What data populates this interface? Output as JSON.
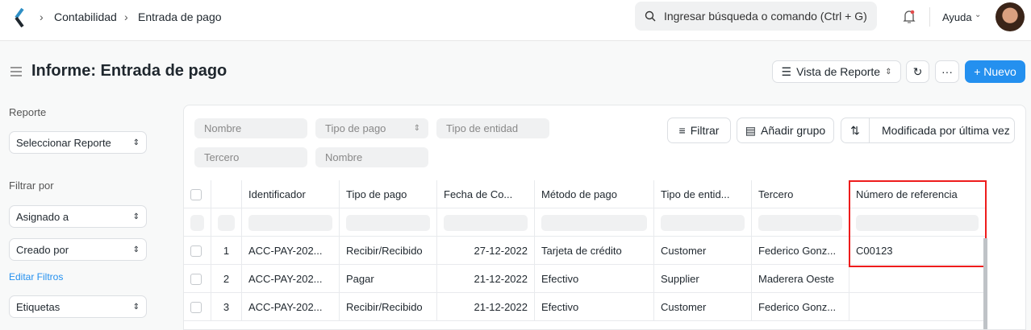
{
  "nav": {
    "breadcrumbs": [
      "Contabilidad",
      "Entrada de pago"
    ],
    "search_placeholder": "Ingresar búsqueda o comando (Ctrl + G)",
    "help": "Ayuda"
  },
  "page": {
    "title": "Informe: Entrada de pago",
    "view": "Vista de Reporte",
    "more": "···",
    "new": "+ Nuevo"
  },
  "sidebar": {
    "report_label": "Reporte",
    "report_select": "Seleccionar Reporte",
    "filter_label": "Filtrar por",
    "assigned": "Asignado a",
    "created": "Creado por",
    "edit_filters": "Editar Filtros",
    "tags": "Etiquetas"
  },
  "filters": {
    "nombre": "Nombre",
    "tipo_pago": "Tipo de pago",
    "tipo_entidad": "Tipo de entidad",
    "tercero": "Tercero",
    "nombre2": "Nombre",
    "filter_btn": "Filtrar",
    "group_btn": "Añadir grupo",
    "sort_btn": "Modificada por última vez"
  },
  "table": {
    "columns": [
      "Identificador",
      "Tipo de pago",
      "Fecha de Co...",
      "Método de pago",
      "Tipo de entid...",
      "Tercero",
      "Número de referencia"
    ],
    "rows": [
      {
        "n": "1",
        "id": "ACC-PAY-202...",
        "tipo": "Recibir/Recibido",
        "fecha": "27-12-2022",
        "metodo": "Tarjeta de crédito",
        "entidad": "Customer",
        "tercero": "Federico Gonz...",
        "ref": "C00123"
      },
      {
        "n": "2",
        "id": "ACC-PAY-202...",
        "tipo": "Pagar",
        "fecha": "21-12-2022",
        "metodo": "Efectivo",
        "entidad": "Supplier",
        "tercero": "Maderera Oeste",
        "ref": ""
      },
      {
        "n": "3",
        "id": "ACC-PAY-202...",
        "tipo": "Recibir/Recibido",
        "fecha": "21-12-2022",
        "metodo": "Efectivo",
        "entidad": "Customer",
        "tercero": "Federico Gonz...",
        "ref": ""
      }
    ]
  },
  "colors": {
    "accent": "#2490ef",
    "highlight": "#ee1c1c"
  }
}
